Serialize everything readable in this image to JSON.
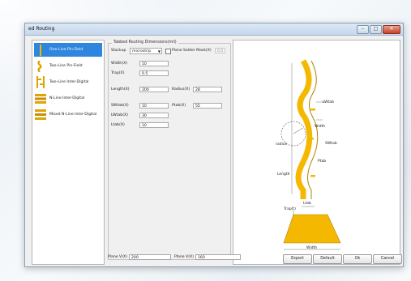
{
  "window": {
    "title": "ed Routing"
  },
  "left_list": [
    {
      "label": "One-Line Pin-Field",
      "icon": "one-line-pin-field-icon",
      "selected": true
    },
    {
      "label": "Two-Line Pin-Field",
      "icon": "two-line-pin-field-icon",
      "selected": false
    },
    {
      "label": "Two-Line Inter-Digital",
      "icon": "two-line-inter-digital-icon",
      "selected": false
    },
    {
      "label": "N-Line Inter-Digital",
      "icon": "n-line-inter-digital-icon",
      "selected": false
    },
    {
      "label": "Mixed N-Line Inter-Digital",
      "icon": "mixed-n-line-inter-digital-icon",
      "selected": false
    }
  ],
  "dims": {
    "group_title": "Tabbed Routing Dimensions(mil)",
    "stackup_label": "Stackup",
    "stackup_value": "microstrip",
    "plane_mask_label": "Plane Solder Mask(X)",
    "plane_mask_value": "0.5",
    "width_label": "Width(X)",
    "width_value": "10",
    "trap_label": "Trap(X)",
    "trap_value": "0.5",
    "length_label": "Length(X)",
    "length_value": "200",
    "radius_label": "Radius(X)",
    "radius_value": "28",
    "swtab_label": "SWtab(X)",
    "swtab_value": "10",
    "ptab_label": "Ptab(X)",
    "ptab_value": "55",
    "lwtab_label": "LWtab(X)",
    "lwtab_value": "30",
    "ltab_label": "Ltab(X)",
    "ltab_value": "10"
  },
  "diagram": {
    "labels": {
      "lwtab": "LWtab",
      "width": "Width",
      "swtab": "SWtab",
      "radius": "radius",
      "ptab": "Ptab",
      "length": "Length",
      "ltab": "Ltab",
      "trap": "Trap(t)",
      "width_bottom": "Width"
    },
    "colors": {
      "trace": "#f5b800",
      "trace_edge": "#b08200"
    }
  },
  "bottom": {
    "plane_v1_label": "Plane V(X)",
    "plane_v1_value": "200",
    "plane_v2_label": "Plane V(X)",
    "plane_v2_value": "160",
    "export": "Export",
    "default": "Default",
    "ok": "Ok",
    "cancel": "Cancel"
  }
}
